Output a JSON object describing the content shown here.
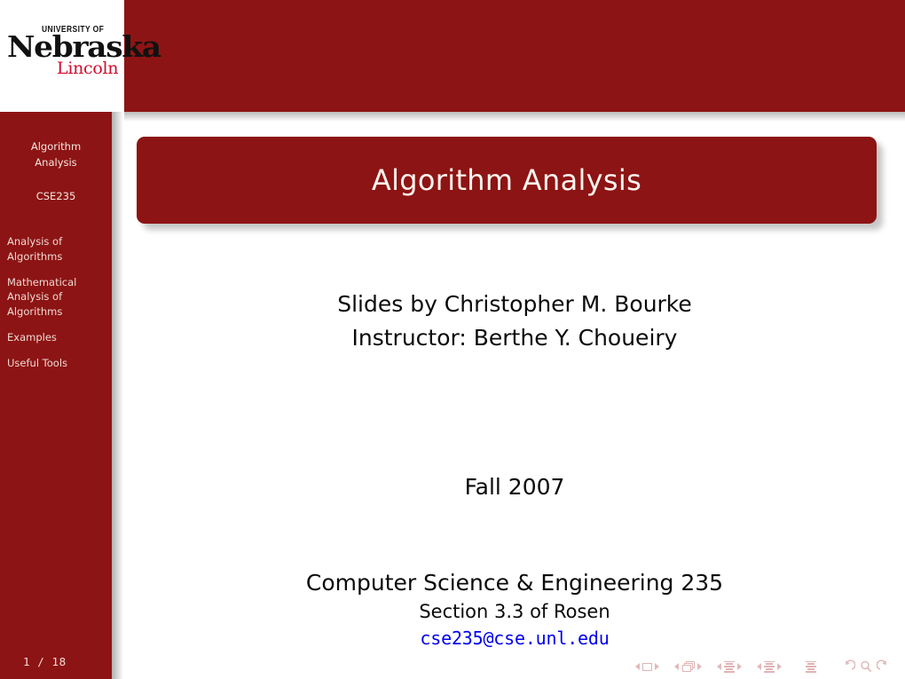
{
  "colors": {
    "brand_red": "#8d1414",
    "sidebar_text": "#eedad4",
    "title_text": "#fdf4ef",
    "link_blue": "#0000ef",
    "logo_lincoln_red": "#cf0a2c",
    "nav_symbol": "#dfb0b0"
  },
  "logo": {
    "line1": "UNIVERSITY OF",
    "line2": "Nebraska",
    "line3": "Lincoln"
  },
  "sidebar": {
    "title_line1": "Algorithm",
    "title_line2": "Analysis",
    "course_code": "CSE235",
    "page_indicator": "1 / 18",
    "items": [
      {
        "label_line1": "Analysis of",
        "label_line2": "Algorithms",
        "label_line3": ""
      },
      {
        "label_line1": "Mathematical",
        "label_line2": "Analysis of",
        "label_line3": "Algorithms"
      },
      {
        "label_line1": "Examples",
        "label_line2": "",
        "label_line3": ""
      },
      {
        "label_line1": "Useful Tools",
        "label_line2": "",
        "label_line3": ""
      }
    ]
  },
  "slide": {
    "title": "Algorithm Analysis",
    "author_line1": "Slides by Christopher M. Bourke",
    "author_line2": "Instructor: Berthe Y. Choueiry",
    "term": "Fall 2007",
    "venue": "Computer Science & Engineering 235",
    "section_reference": "Section 3.3 of Rosen",
    "email": "cse235@cse.unl.edu"
  },
  "navigation_symbols": {
    "slide_prev": "triangle-left",
    "slide_current": "slide-icon",
    "slide_next": "triangle-right",
    "frame_prev": "triangle-left",
    "frame_current": "frame-icon",
    "frame_next": "triangle-right",
    "subsection_prev": "triangle-left",
    "subsection_current": "subsection-icon",
    "subsection_next": "triangle-right",
    "section_prev": "triangle-left",
    "section_current": "section-icon",
    "section_next": "triangle-right",
    "document": "document-icon",
    "back": "back-icon",
    "search": "search-icon",
    "forward": "forward-icon"
  }
}
